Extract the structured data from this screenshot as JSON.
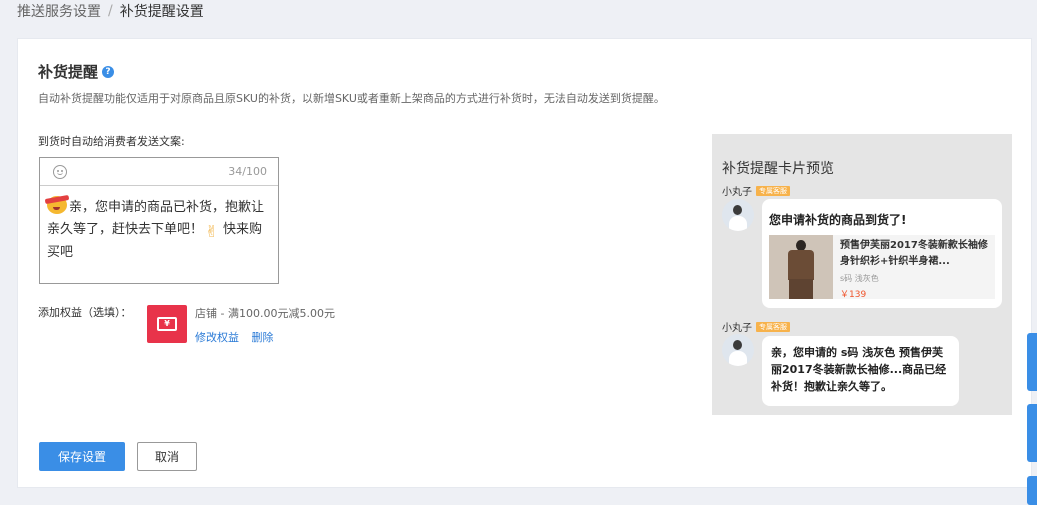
{
  "breadcrumb": {
    "parent": "推送服务设置",
    "separator": "/",
    "current": "补货提醒设置"
  },
  "header": {
    "title": "补货提醒",
    "help": "?",
    "description": "自动补货提醒功能仅适用于对原商品且原SKU的补货，以新增SKU或者重新上架商品的方式进行补货时，无法自动发送到货提醒。"
  },
  "form": {
    "send_label": "到货时自动给消费者发送文案:",
    "editor": {
      "counter": "34/100",
      "text_part1": "亲，您申请的商品已补货，抱歉让亲久等了，赶快去下单吧！",
      "text_part2": "快来购买吧"
    },
    "benefit_label": "添加权益（选填）：",
    "benefit_icon_text": "¥",
    "benefit_desc": "店铺 - 满100.00元减5.00元",
    "edit_benefit": "修改权益",
    "delete": "删除"
  },
  "buttons": {
    "save": "保存设置",
    "cancel": "取消"
  },
  "preview": {
    "title": "补货提醒卡片预览",
    "sender": "小丸子",
    "tag": "专属客服",
    "card_title": "您申请补货的商品到货了!",
    "product_name": "预售伊芙丽2017冬装新款长袖修身针织衫+针织半身裙...",
    "product_sku": "s码 浅灰色",
    "product_price": "￥139",
    "message": "亲，您申请的 s码 浅灰色 预售伊芙丽2017冬装新款长袖修...商品已经补货！抱歉让亲久等了。"
  },
  "colors": {
    "primary": "#3a8ee6",
    "benefit": "#e8334a",
    "price": "#f0542b"
  },
  "icons": [
    "help-icon",
    "smiley-icon",
    "ticket-icon",
    "avatar-icon"
  ]
}
